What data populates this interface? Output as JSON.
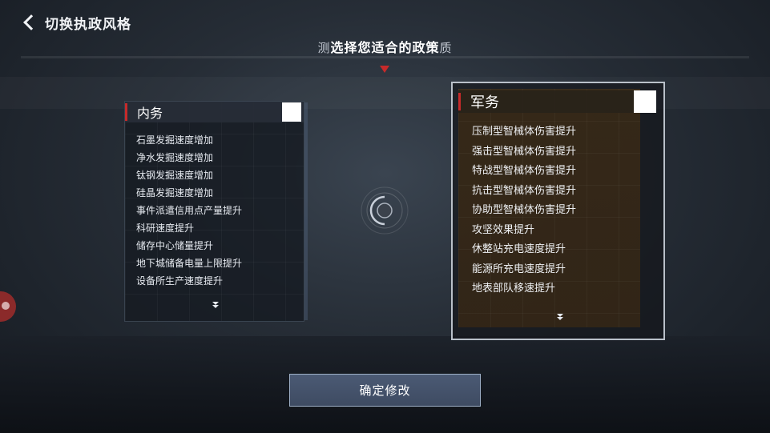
{
  "header": {
    "title": "切换执政风格",
    "back_icon": "chevron-left-icon"
  },
  "subtitle": {
    "prefix": "测",
    "main": "选择您适合的政策",
    "suffix": "质"
  },
  "panels": {
    "left": {
      "title": "内务",
      "items": [
        "石墨发掘速度增加",
        "净水发掘速度增加",
        "钛钢发掘速度增加",
        "硅晶发掘速度增加",
        "事件派遣信用点产量提升",
        "科研速度提升",
        "储存中心储量提升",
        "地下城储备电量上限提升",
        "设备所生产速度提升"
      ],
      "selected": false
    },
    "right": {
      "title": "军务",
      "items": [
        "压制型智械体伤害提升",
        "强击型智械体伤害提升",
        "特战型智械体伤害提升",
        "抗击型智械体伤害提升",
        "协助型智械体伤害提升",
        "攻坚效果提升",
        "休整站充电速度提升",
        "能源所充电速度提升",
        "地表部队移速提升"
      ],
      "selected": true
    }
  },
  "confirm_button": {
    "label": "确定修改"
  },
  "colors": {
    "accent": "#c62a2a",
    "button": "#46546c",
    "right_panel": "#3a2a16"
  }
}
